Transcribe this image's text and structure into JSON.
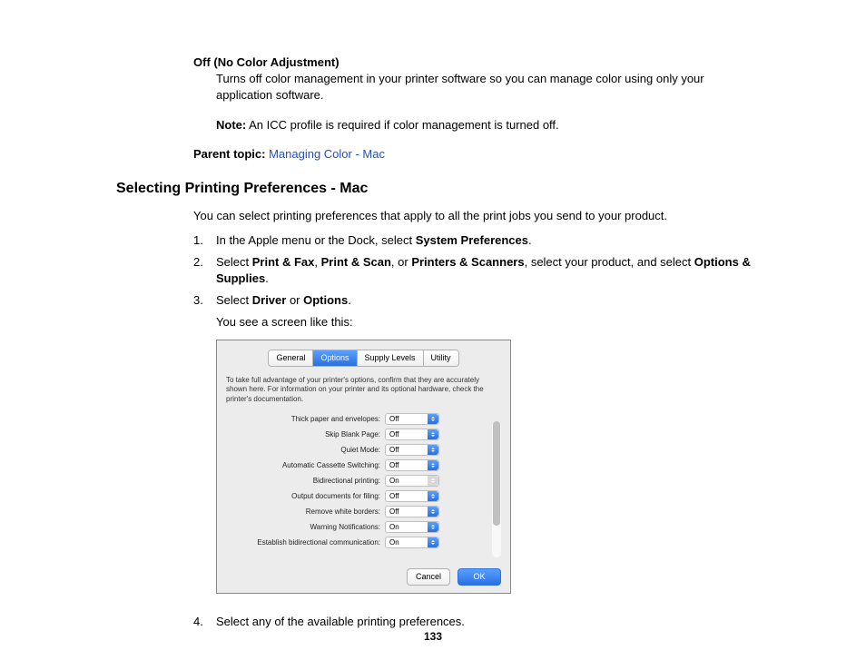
{
  "top": {
    "off_title": "Off (No Color Adjustment)",
    "off_body": "Turns off color management in your printer software so you can manage color using only your application software.",
    "note_label": "Note:",
    "note_body": " An ICC profile is required if color management is turned off.",
    "parent_label": "Parent topic:",
    "parent_link": " Managing Color - Mac"
  },
  "section_title": "Selecting Printing Preferences - Mac",
  "intro": "You can select printing preferences that apply to all the print jobs you send to your product.",
  "steps": {
    "s1": {
      "num": "1.",
      "pre": "In the Apple menu or the Dock, select ",
      "b1": "System Preferences",
      "post": "."
    },
    "s2": {
      "num": "2.",
      "pre": "Select ",
      "b1": "Print & Fax",
      "m1": ", ",
      "b2": "Print & Scan",
      "m2": ", or ",
      "b3": "Printers & Scanners",
      "m3": ", select your product, and select ",
      "b4": "Options & Supplies",
      "post": "."
    },
    "s3": {
      "num": "3.",
      "pre": "Select ",
      "b1": "Driver",
      "m1": " or ",
      "b2": "Options",
      "post": ".",
      "sub": "You see a screen like this:"
    },
    "s4": {
      "num": "4.",
      "body": "Select any of the available printing preferences."
    }
  },
  "dialog": {
    "tabs": {
      "general": "General",
      "options": "Options",
      "supply": "Supply Levels",
      "utility": "Utility"
    },
    "help": "To take full advantage of your printer's options, confirm that they are accurately shown here. For information on your printer and its optional hardware, check the printer's documentation.",
    "rows": [
      {
        "label": "Thick paper and envelopes:",
        "value": "Off",
        "enabled": true
      },
      {
        "label": "Skip Blank Page:",
        "value": "Off",
        "enabled": true
      },
      {
        "label": "Quiet Mode:",
        "value": "Off",
        "enabled": true
      },
      {
        "label": "Automatic Cassette Switching:",
        "value": "Off",
        "enabled": true
      },
      {
        "label": "Bidirectional printing:",
        "value": "On",
        "enabled": false
      },
      {
        "label": "Output documents for filing:",
        "value": "Off",
        "enabled": true
      },
      {
        "label": "Remove white borders:",
        "value": "Off",
        "enabled": true
      },
      {
        "label": "Warning Notifications:",
        "value": "On",
        "enabled": true
      },
      {
        "label": "Establish bidirectional communication:",
        "value": "On",
        "enabled": true
      }
    ],
    "cancel": "Cancel",
    "ok": "OK"
  },
  "page_number": "133"
}
